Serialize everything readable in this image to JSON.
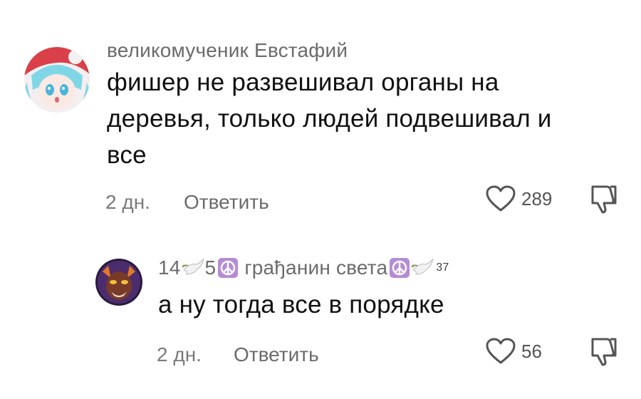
{
  "comments": [
    {
      "author": "великомученик Евстафий",
      "text_lines": [
        "фишер не развешивал органы на",
        "деревья, только людей подвешивал и",
        "все"
      ],
      "time": "2 дн.",
      "reply_label": "Ответить",
      "likes": "289"
    },
    {
      "author_prefix_1": "14",
      "author_prefix_2": "5",
      "author_name": "грађанин света",
      "author_sup": "37",
      "text": "а ну тогда все в порядке",
      "time": "2 дн.",
      "reply_label": "Ответить",
      "likes": "56"
    }
  ],
  "icons": {
    "like": "heart-outline-icon",
    "dislike": "thumbs-down-icon",
    "dove": "dove-icon",
    "peace": "peace-symbol-icon"
  },
  "colors": {
    "peace_bg": "#b68bd6",
    "muted_text": "#6b6b6b"
  }
}
